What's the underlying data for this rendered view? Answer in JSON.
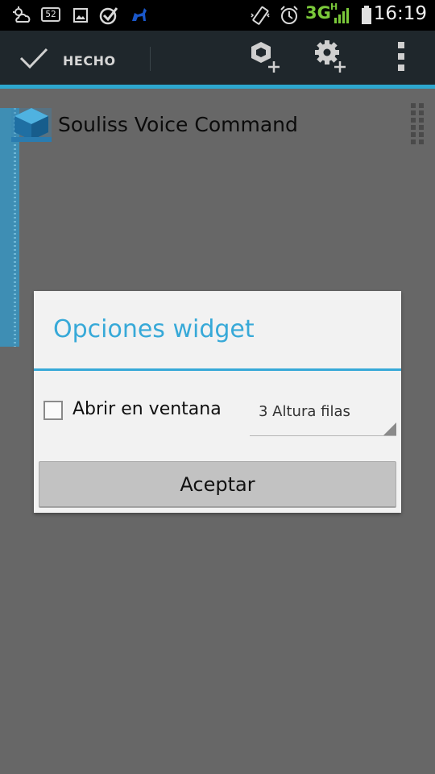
{
  "status_bar": {
    "notification_badge": "52",
    "network_label": "3G",
    "network_sub": "H",
    "time": "16:19",
    "icons": [
      "weather-icon",
      "badge-52-icon",
      "gallery-icon",
      "check-circle-icon",
      "animal-app-icon",
      "vibrate-icon",
      "alarm-icon",
      "signal-icon",
      "battery-icon"
    ]
  },
  "action_bar": {
    "done_label": "HECHO",
    "done_icon": "checkmark-icon",
    "add_widget_icon": "add-widget-icon",
    "add_settings_icon": "add-settings-icon",
    "overflow_icon": "overflow-menu-icon",
    "accent_color": "#2da7cf"
  },
  "widget_list": {
    "item_title": "Souliss Voice Command",
    "item_icon": "app-cube-icon",
    "handle_icon": "drag-handle-icon"
  },
  "dialog": {
    "title": "Opciones widget",
    "checkbox_label": "Abrir en ventana",
    "checkbox_checked": false,
    "spinner_selected": "3 Altura filas",
    "accept_label": "Aceptar",
    "title_color": "#37a9d8"
  }
}
